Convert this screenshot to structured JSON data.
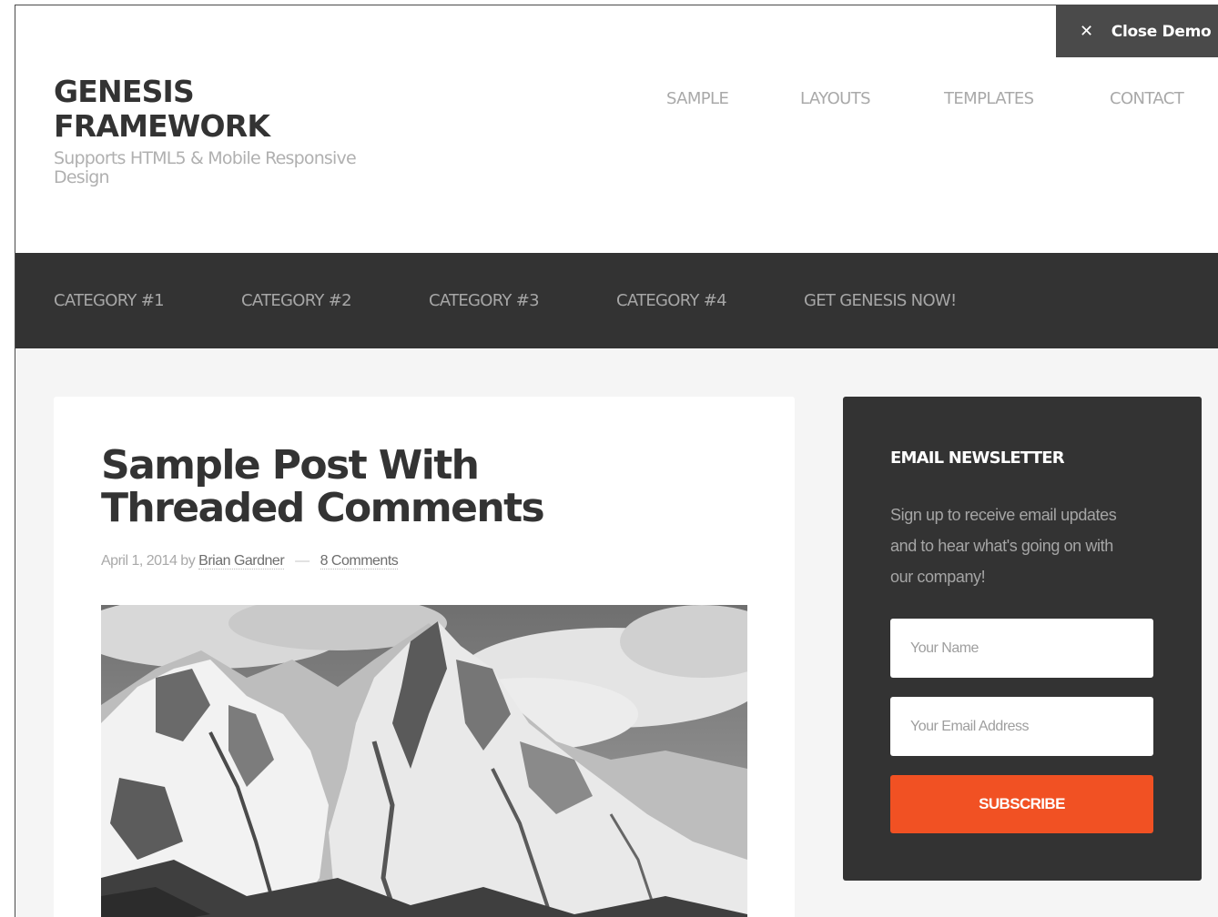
{
  "close_demo": {
    "icon": "close-icon",
    "label": "Close Demo"
  },
  "header": {
    "site_title": "GENESIS FRAMEWORK",
    "description": "Supports HTML5 & Mobile Responsive Design",
    "nav": [
      "SAMPLE",
      "LAYOUTS",
      "TEMPLATES",
      "CONTACT"
    ]
  },
  "category_nav": [
    "CATEGORY #1",
    "CATEGORY #2",
    "CATEGORY #3",
    "CATEGORY #4",
    "GET GENESIS NOW!"
  ],
  "post": {
    "title": "Sample Post With Threaded Comments",
    "date": "April 1, 2014",
    "by": "by",
    "author": "Brian Gardner",
    "separator": "—",
    "comments": "8 Comments"
  },
  "newsletter": {
    "title": "EMAIL NEWSLETTER",
    "text": "Sign up to receive email updates and to hear what's going on with our company!",
    "name_placeholder": "Your Name",
    "email_placeholder": "Your Email Address",
    "subscribe_label": "SUBSCRIBE"
  },
  "colors": {
    "dark_bar": "#333333",
    "accent": "#f15123",
    "page_bg": "#f5f5f5"
  }
}
